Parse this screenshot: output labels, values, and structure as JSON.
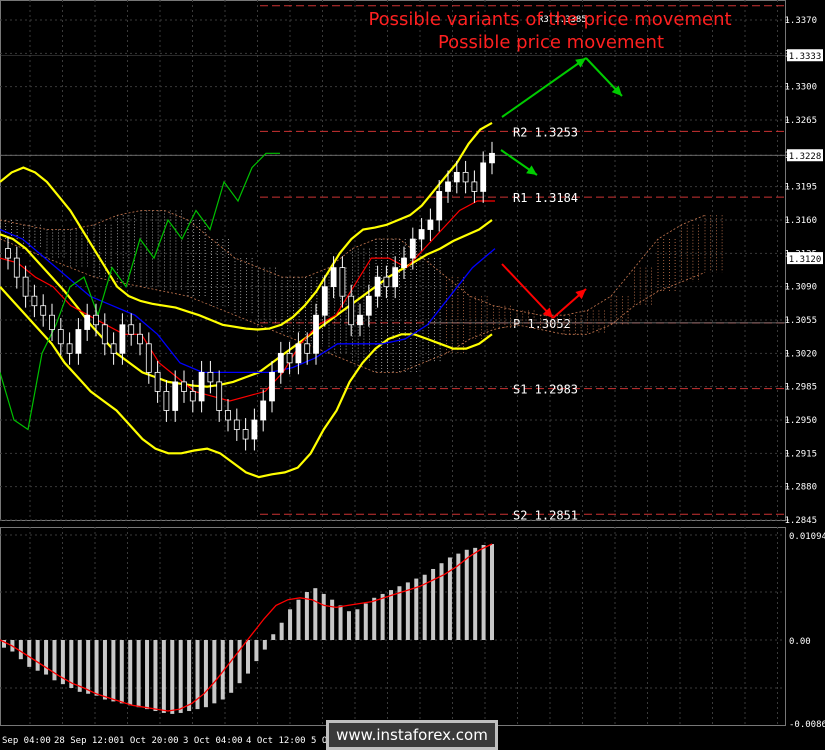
{
  "titles": {
    "line1": "Possible variants of the price movement",
    "line2": "Possible price movement",
    "r3_label": "R3 1.3385"
  },
  "watermark": "www.instaforex.com",
  "colors": {
    "background": "#000000",
    "grid": "#3a3a3a",
    "candle_up": "#ffffff",
    "candle_down": "#ffffff",
    "bollinger": "#ffff00",
    "kijun": "#0000ff",
    "tenkan": "#ff0000",
    "chikou": "#00c000",
    "pivot_lines": "#cc3333",
    "title": "#ff2020",
    "up_arrow": "#00cc00",
    "down_arrow": "#ff0000",
    "histogram": "#c8c8c8",
    "signal": "#ff0000"
  },
  "chart_data": [
    {
      "type": "candlestick",
      "instrument_note": "",
      "ylim": [
        1.2845,
        1.3385
      ],
      "y_ticks": [
        "1.3370",
        "1.3335",
        "1.3300",
        "1.3265",
        "1.3228",
        "1.3195",
        "1.3160",
        "1.3125",
        "1.3090",
        "1.3055",
        "1.3020",
        "1.2985",
        "1.2950",
        "1.2915",
        "1.2880",
        "1.2845"
      ],
      "price_markers": [
        {
          "label": "1.3333",
          "value": 1.3333
        },
        {
          "label": "1.3228",
          "value": 1.3228
        },
        {
          "label": "1.3120",
          "value": 1.312
        }
      ],
      "x_ticks": [
        "Sep 04:00",
        "28 Sep 12:00",
        "1 Oct 20:00",
        "3 Oct 04:00",
        "4 Oct 12:00",
        "5 Oct"
      ],
      "levels": [
        {
          "name": "R3",
          "label": "R3 1.3385",
          "value": 1.3385
        },
        {
          "name": "R2",
          "label": "R2 1.3253",
          "value": 1.3253
        },
        {
          "name": "R1",
          "label": "R1 1.3184",
          "value": 1.3184
        },
        {
          "name": "P",
          "label": "P 1.3052",
          "value": 1.3052
        },
        {
          "name": "S1",
          "label": "S1 1.2983",
          "value": 1.2983
        },
        {
          "name": "S2",
          "label": "S2 1.2851",
          "value": 1.2851
        }
      ],
      "candles_close": [
        1.312,
        1.31,
        1.308,
        1.307,
        1.306,
        1.3045,
        1.303,
        1.302,
        1.3045,
        1.306,
        1.305,
        1.303,
        1.302,
        1.305,
        1.304,
        1.303,
        1.3,
        1.298,
        1.296,
        1.299,
        1.298,
        1.297,
        1.3,
        1.299,
        1.296,
        1.295,
        1.294,
        1.293,
        1.295,
        1.297,
        1.3,
        1.302,
        1.301,
        1.303,
        1.302,
        1.306,
        1.309,
        1.311,
        1.308,
        1.305,
        1.306,
        1.308,
        1.31,
        1.309,
        1.311,
        1.312,
        1.314,
        1.315,
        1.316,
        1.319,
        1.32,
        1.321,
        1.32,
        1.319,
        1.322,
        1.323
      ],
      "bollinger_upper": [
        1.32,
        1.321,
        1.3215,
        1.321,
        1.32,
        1.3185,
        1.317,
        1.315,
        1.313,
        1.311,
        1.309,
        1.308,
        1.3075,
        1.3072,
        1.307,
        1.3068,
        1.3064,
        1.306,
        1.3055,
        1.305,
        1.3048,
        1.3046,
        1.3045,
        1.3046,
        1.305,
        1.3058,
        1.307,
        1.3085,
        1.3105,
        1.3125,
        1.314,
        1.315,
        1.3152,
        1.3155,
        1.316,
        1.3165,
        1.3175,
        1.319,
        1.3205,
        1.322,
        1.324,
        1.3255,
        1.3262
      ],
      "bollinger_middle": [
        1.3145,
        1.314,
        1.313,
        1.3115,
        1.31,
        1.3085,
        1.3068,
        1.305,
        1.3035,
        1.302,
        1.301,
        1.3,
        1.2995,
        1.299,
        1.2988,
        1.2986,
        1.2985,
        1.2987,
        1.299,
        1.2995,
        1.3,
        1.301,
        1.302,
        1.303,
        1.304,
        1.305,
        1.306,
        1.307,
        1.308,
        1.309,
        1.31,
        1.3108,
        1.3116,
        1.3124,
        1.313,
        1.3138,
        1.3144,
        1.315,
        1.316
      ],
      "bollinger_lower": [
        1.309,
        1.3075,
        1.306,
        1.3045,
        1.303,
        1.301,
        1.2995,
        1.298,
        1.297,
        1.296,
        1.2945,
        1.293,
        1.292,
        1.2915,
        1.2915,
        1.2918,
        1.292,
        1.2915,
        1.2905,
        1.2895,
        1.289,
        1.2893,
        1.2895,
        1.29,
        1.2915,
        1.294,
        1.296,
        1.299,
        1.301,
        1.3025,
        1.3035,
        1.304,
        1.304,
        1.3035,
        1.303,
        1.3025,
        1.3025,
        1.303,
        1.304
      ],
      "tenkan": [
        1.312,
        1.3115,
        1.31,
        1.309,
        1.307,
        1.306,
        1.305,
        1.304,
        1.304,
        1.301,
        1.2995,
        1.298,
        1.2975,
        1.297,
        1.2975,
        1.298,
        1.3,
        1.303,
        1.305,
        1.306,
        1.309,
        1.312,
        1.312,
        1.311,
        1.313,
        1.315,
        1.317,
        1.318,
        1.318
      ],
      "kijun": [
        1.315,
        1.314,
        1.312,
        1.31,
        1.308,
        1.307,
        1.306,
        1.304,
        1.301,
        1.3,
        1.3,
        1.3,
        1.3,
        1.3005,
        1.3015,
        1.303,
        1.303,
        1.303,
        1.3035,
        1.305,
        1.308,
        1.311,
        1.313
      ],
      "chikou": [
        1.3,
        1.295,
        1.294,
        1.302,
        1.305,
        1.309,
        1.31,
        1.306,
        1.311,
        1.309,
        1.314,
        1.312,
        1.316,
        1.314,
        1.317,
        1.315,
        1.32,
        1.318,
        1.3215,
        1.323,
        1.323
      ],
      "cloud_upper": [
        1.316,
        1.3155,
        1.315,
        1.315,
        1.3155,
        1.3165,
        1.317,
        1.317,
        1.316,
        1.314,
        1.312,
        1.311,
        1.31,
        1.31,
        1.311,
        1.313,
        1.314,
        1.314,
        1.312,
        1.31,
        1.308,
        1.307,
        1.3065,
        1.306,
        1.306,
        1.3065,
        1.308,
        1.311,
        1.314,
        1.3155,
        1.3165
      ],
      "cloud_lower": [
        1.314,
        1.313,
        1.312,
        1.311,
        1.31,
        1.3095,
        1.309,
        1.3085,
        1.308,
        1.307,
        1.306,
        1.305,
        1.304,
        1.303,
        1.302,
        1.301,
        1.3,
        1.3,
        1.301,
        1.302,
        1.3035,
        1.3045,
        1.305,
        1.3045,
        1.304,
        1.304,
        1.305,
        1.307,
        1.3085,
        1.3095,
        1.3105
      ]
    },
    {
      "type": "bar",
      "indicator": "",
      "ylim": [
        -0.00867,
        0.01094
      ],
      "y_ticks": [
        "0.01094",
        "0.00",
        "-0.00867"
      ],
      "values": [
        -0.0008,
        -0.0012,
        -0.002,
        -0.0028,
        -0.0032,
        -0.0036,
        -0.0042,
        -0.0046,
        -0.005,
        -0.0054,
        -0.0056,
        -0.0058,
        -0.0062,
        -0.0064,
        -0.0066,
        -0.0068,
        -0.007,
        -0.0072,
        -0.0074,
        -0.0076,
        -0.0077,
        -0.0076,
        -0.0074,
        -0.0072,
        -0.007,
        -0.0066,
        -0.0062,
        -0.0055,
        -0.0045,
        -0.0035,
        -0.0022,
        -0.001,
        0.0006,
        0.0018,
        0.0032,
        0.0042,
        0.005,
        0.0054,
        0.0048,
        0.0042,
        0.0036,
        0.003,
        0.0032,
        0.0038,
        0.0044,
        0.0048,
        0.0052,
        0.0056,
        0.006,
        0.0064,
        0.0068,
        0.0074,
        0.008,
        0.0086,
        0.009,
        0.0094,
        0.0096,
        0.0099,
        0.01
      ],
      "signal": [
        0.0,
        -0.0006,
        -0.0014,
        -0.0022,
        -0.003,
        -0.0038,
        -0.0045,
        -0.005,
        -0.0056,
        -0.006,
        -0.0064,
        -0.0068,
        -0.007,
        -0.0072,
        -0.0074,
        -0.0072,
        -0.0066,
        -0.0056,
        -0.0042,
        -0.0026,
        -0.001,
        0.0006,
        0.0022,
        0.0036,
        0.0042,
        0.0044,
        0.0042,
        0.0036,
        0.0034,
        0.0036,
        0.0038,
        0.004,
        0.0044,
        0.0048,
        0.0052,
        0.0056,
        0.0062,
        0.0068,
        0.0076,
        0.0086,
        0.0094,
        0.01
      ]
    }
  ]
}
